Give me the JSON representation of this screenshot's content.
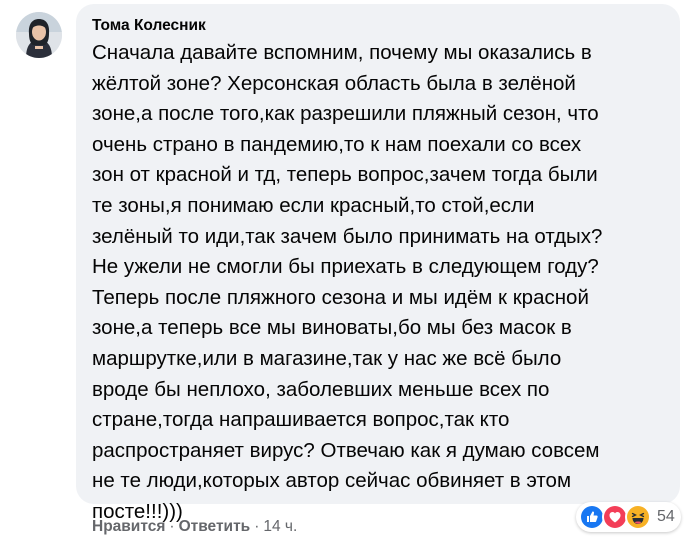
{
  "comment": {
    "author": "Тома Колесник",
    "lines": [
      "Сначала давайте вспомним, почему мы оказались в",
      "жёлтой зоне? Херсонская область была в зелёной",
      "зоне,а после того,как разрешили пляжный сезон, что",
      "очень страно в пандемию,то к нам поехали со всех",
      "зон от красной и тд, теперь вопрос,зачем тогда были",
      "те зоны,я понимаю если красный,то стой,если",
      "зелёный то иди,так зачем было принимать на отдых?",
      "Не ужели не смогли бы приехать в следующем году?",
      "Теперь после пляжного сезона и мы идём к красной",
      "зоне,а теперь все мы виноваты,бо мы без масок в",
      "маршрутке,или в магазине,так у нас же всё было",
      "вроде бы неплохо, заболевших меньше всех по",
      "стране,тогда напрашивается вопрос,так кто",
      "распространяет вирус? Отвечаю как я думаю совсем",
      "не те люди,которых автор сейчас обвиняет в этом",
      "посте!!!)))"
    ]
  },
  "actions": {
    "like_label": "Нравится",
    "separator": "·",
    "reply_label": "Ответить",
    "time": "14 ч."
  },
  "reactions": {
    "icons": [
      "like-icon",
      "love-icon",
      "haha-icon"
    ],
    "count": "54",
    "colors": {
      "like": "#1877f2",
      "love": "#f33e58",
      "haha": "#f7b125"
    }
  },
  "colors": {
    "bubble_bg": "#f0f2f5",
    "text": "#050505",
    "secondary": "#65676b"
  }
}
